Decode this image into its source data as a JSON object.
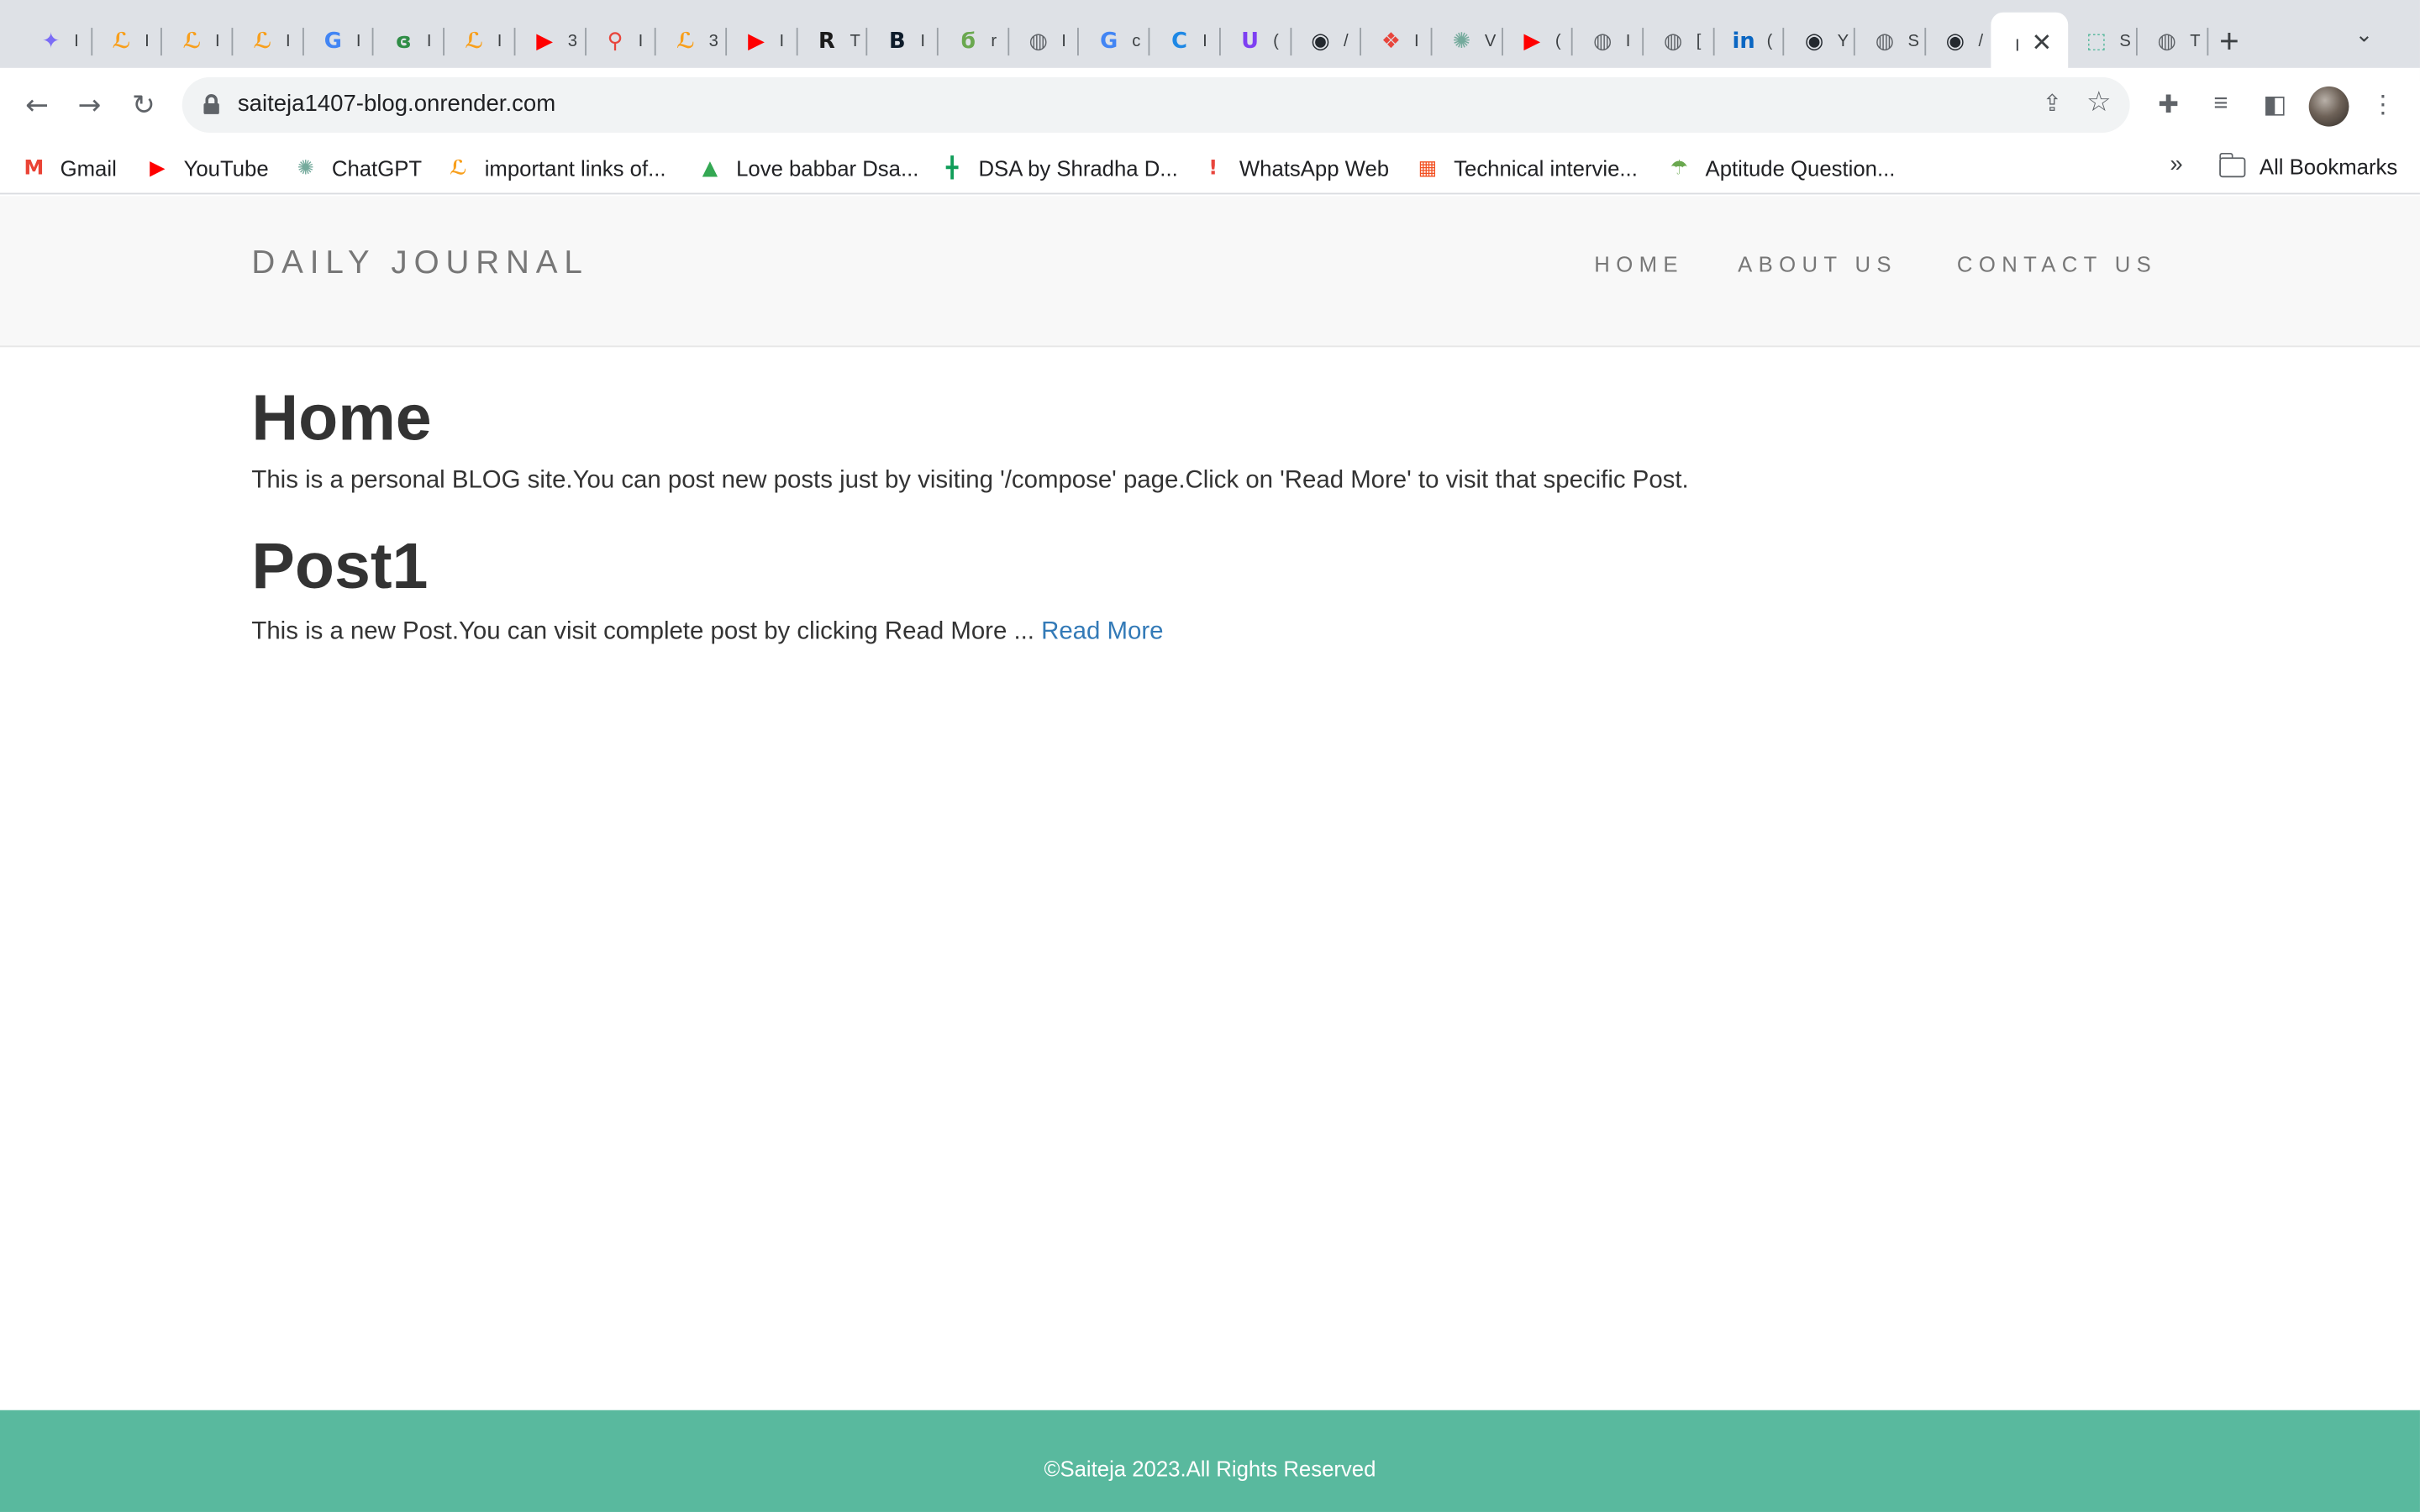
{
  "browser": {
    "tabs": [
      {
        "icon": "gemini-icon",
        "color": "#7b6cf6",
        "glyph": "✦",
        "char": "I"
      },
      {
        "icon": "leetcode-icon",
        "color": "#f89f1b",
        "glyph": "ℒ",
        "char": "I"
      },
      {
        "icon": "leetcode-icon",
        "color": "#f89f1b",
        "glyph": "ℒ",
        "char": "I"
      },
      {
        "icon": "leetcode-icon",
        "color": "#f89f1b",
        "glyph": "ℒ",
        "char": "I"
      },
      {
        "icon": "google-icon",
        "color": "#4285f4",
        "glyph": "G",
        "char": "I"
      },
      {
        "icon": "geeksforgeeks-icon",
        "color": "#2f8d46",
        "glyph": "ɞ",
        "char": "I"
      },
      {
        "icon": "leetcode-icon",
        "color": "#f89f1b",
        "glyph": "ℒ",
        "char": "I"
      },
      {
        "icon": "youtube-icon",
        "color": "#ff0000",
        "glyph": "▶",
        "char": "3"
      },
      {
        "icon": "rocket-icon",
        "color": "#e8453c",
        "glyph": "⚲",
        "char": "I"
      },
      {
        "icon": "leetcode-icon",
        "color": "#f89f1b",
        "glyph": "ℒ",
        "char": "3"
      },
      {
        "icon": "youtube-icon",
        "color": "#ff0000",
        "glyph": "▶",
        "char": "I"
      },
      {
        "icon": "r-icon",
        "color": "#1b1b1b",
        "glyph": "R",
        "char": "T"
      },
      {
        "icon": "b-icon",
        "color": "#0d1b2a",
        "glyph": "B",
        "char": "I"
      },
      {
        "icon": "leaf-icon",
        "color": "#6aa84f",
        "glyph": "ϭ",
        "char": "r"
      },
      {
        "icon": "globe-icon",
        "color": "#5f6368",
        "glyph": "◍",
        "char": "I"
      },
      {
        "icon": "google-icon",
        "color": "#4285f4",
        "glyph": "G",
        "char": "c"
      },
      {
        "icon": "c-icon",
        "color": "#1e88e5",
        "glyph": "C",
        "char": "I"
      },
      {
        "icon": "u-icon",
        "color": "#7e3ff2",
        "glyph": "U",
        "char": "("
      },
      {
        "icon": "github-icon",
        "color": "#24292f",
        "glyph": "◉",
        "char": "/"
      },
      {
        "icon": "puzzle-icon",
        "color": "#e8453c",
        "glyph": "❖",
        "char": "I"
      },
      {
        "icon": "chatgpt-icon",
        "color": "#74aa9c",
        "glyph": "✺",
        "char": "V"
      },
      {
        "icon": "youtube-icon",
        "color": "#ff0000",
        "glyph": "▶",
        "char": "("
      },
      {
        "icon": "globe-icon",
        "color": "#5f6368",
        "glyph": "◍",
        "char": "I"
      },
      {
        "icon": "globe-icon",
        "color": "#5f6368",
        "glyph": "◍",
        "char": "["
      },
      {
        "icon": "linkedin-icon",
        "color": "#0a66c2",
        "glyph": "in",
        "char": "("
      },
      {
        "icon": "github-icon",
        "color": "#24292f",
        "glyph": "◉",
        "char": "Y"
      },
      {
        "icon": "globe-icon",
        "color": "#5f6368",
        "glyph": "◍",
        "char": "S"
      },
      {
        "icon": "github-icon",
        "color": "#24292f",
        "glyph": "◉",
        "char": "/"
      },
      {
        "icon": "page-icon",
        "color": "#ffffff",
        "glyph": "",
        "char": "I",
        "active": true
      },
      {
        "icon": "square-dashed-icon",
        "color": "#59b99e",
        "glyph": "⬚",
        "char": "S"
      },
      {
        "icon": "globe-icon",
        "color": "#5f6368",
        "glyph": "◍",
        "char": "T"
      }
    ],
    "url": "saiteja1407-blog.onrender.com",
    "bookmarks": [
      {
        "label": "Gmail",
        "icon": "gmail-icon",
        "color": "#ea4335",
        "glyph": "M"
      },
      {
        "label": "YouTube",
        "icon": "youtube-icon",
        "color": "#ff0000",
        "glyph": "▶"
      },
      {
        "label": "ChatGPT",
        "icon": "chatgpt-icon",
        "color": "#74aa9c",
        "glyph": "✺"
      },
      {
        "label": "important links of...",
        "icon": "leetcode-icon",
        "color": "#f89f1b",
        "glyph": "ℒ"
      },
      {
        "label": "Love babbar Dsa...",
        "icon": "google-drive-icon",
        "color": "#34a853",
        "glyph": "▲"
      },
      {
        "label": "DSA by Shradha D...",
        "icon": "google-sheets-icon",
        "color": "#0f9d58",
        "glyph": "╋"
      },
      {
        "label": "WhatsApp Web",
        "icon": "alert-icon",
        "color": "#e8453c",
        "glyph": "!"
      },
      {
        "label": "Technical intervie...",
        "icon": "microsoft-icon",
        "color": "#f25022",
        "glyph": "▦"
      },
      {
        "label": "Aptitude Question...",
        "icon": "umbrella-icon",
        "color": "#6aa84f",
        "glyph": "☂"
      }
    ],
    "all_bookmarks_label": "All Bookmarks"
  },
  "site": {
    "brand": "DAILY JOURNAL",
    "nav": [
      "HOME",
      "ABOUT US",
      "CONTACT US"
    ],
    "home_title": "Home",
    "home_text": "This is a personal BLOG site.You can post new posts just by visiting '/compose' page.Click on 'Read More' to visit that specific Post.",
    "posts": [
      {
        "title": "Post1",
        "excerpt": "This is a new Post.You can visit complete post by clicking Read More ... ",
        "link_label": "Read More"
      }
    ],
    "footer": "©Saiteja 2023.All Rights Reserved"
  },
  "colors": {
    "footer": "#59b99e",
    "link": "#337ab7",
    "header_bg": "#f8f8f8",
    "tab_strip": "#dee1e6"
  }
}
